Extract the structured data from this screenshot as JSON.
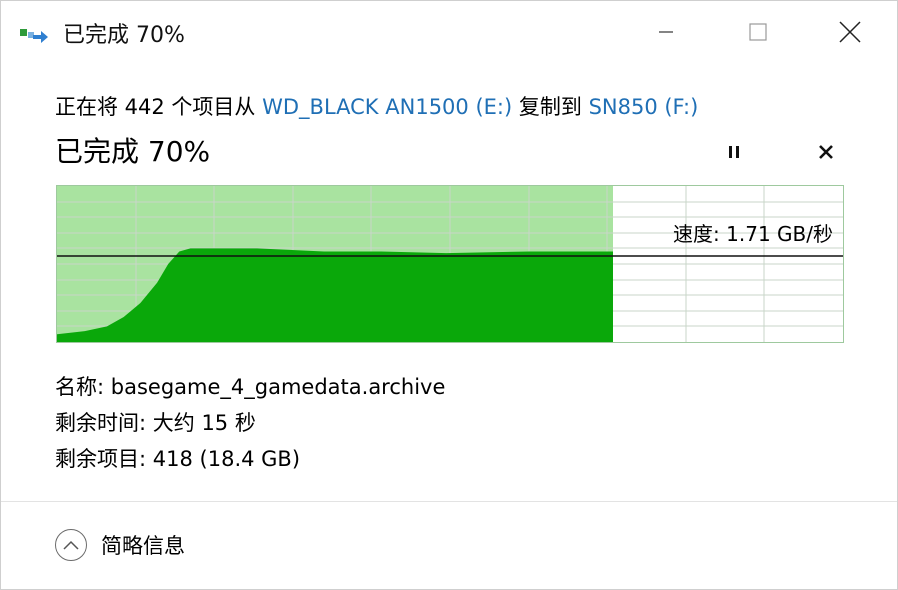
{
  "window": {
    "title": "已完成 70%"
  },
  "copy_info": {
    "prefix": "正在将 442 个项目从",
    "source": "WD_BLACK AN1500 (E:)",
    "middle": "复制到",
    "destination": "SN850 (F:)"
  },
  "progress": {
    "title": "已完成 70%",
    "percent": 70
  },
  "graph": {
    "speed_label": "速度: 1.71 GB/秒",
    "current_speed_gb_per_s": 1.71
  },
  "details": {
    "name_label": "名称:",
    "name_value": "basegame_4_gamedata.archive",
    "time_label": "剩余时间:",
    "time_value": "大约 15 秒",
    "items_label": "剩余项目:",
    "items_value": "418 (18.4 GB)"
  },
  "footer": {
    "toggle_label": "简略信息"
  },
  "colors": {
    "link": "#1f6fb5",
    "graph_fill": "#0aa80a",
    "graph_progress_bg": "#a9e3a0",
    "graph_grid": "#c9d6c9"
  },
  "icons": {
    "app": "copy-transfer-icon",
    "minimize": "minimize-icon",
    "maximize": "maximize-icon",
    "close": "close-icon",
    "pause": "pause-icon",
    "cancel": "cancel-icon",
    "toggle": "chevron-up-icon"
  }
}
